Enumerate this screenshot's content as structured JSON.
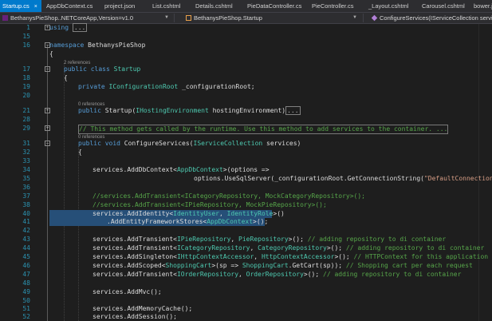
{
  "tabs": [
    {
      "label": "Startup.cs",
      "active": true
    },
    {
      "label": "AppDbContext.cs"
    },
    {
      "label": "project.json"
    },
    {
      "label": "List.cshtml"
    },
    {
      "label": "Details.cshtml"
    },
    {
      "label": "PieDataController.cs"
    },
    {
      "label": "PieController.cs"
    },
    {
      "label": "_Layout.cshtml"
    },
    {
      "label": "Carousel.cshtml"
    },
    {
      "label": "bower.js"
    }
  ],
  "nav": {
    "project": "BethanysPieShop..NETCoreApp,Version=v1.0",
    "class": "BethanysPieShop.Startup",
    "member": "ConfigureServices(IServiceCollection services)"
  },
  "colors": {
    "accent": "#007acc",
    "keyword": "#569cd6",
    "type": "#4ec9b0",
    "comment": "#57a64a",
    "string": "#d69d85",
    "linenum": "#2b91af",
    "selection": "#264f78"
  },
  "lines": [
    {
      "n": "1",
      "t": "using ..."
    },
    {
      "n": "15",
      "t": ""
    },
    {
      "n": "16",
      "t": "namespace BethanysPieShop"
    },
    {
      "n": "",
      "t": "{"
    },
    {
      "ref": "2 references"
    },
    {
      "n": "17",
      "t": "public class Startup"
    },
    {
      "n": "18",
      "t": "{"
    },
    {
      "n": "19",
      "t": "private IConfigurationRoot _configurationRoot;"
    },
    {
      "n": "20",
      "t": ""
    },
    {
      "ref": "0 references"
    },
    {
      "n": "21",
      "t": "public Startup(IHostingEnvironment hostingEnvironment)..."
    },
    {
      "n": "28",
      "t": ""
    },
    {
      "n": "29",
      "t": "// This method gets called by the runtime. Use this method to add services to the container. ..."
    },
    {
      "ref": "0 references"
    },
    {
      "n": "31",
      "t": "public void ConfigureServices(IServiceCollection services)"
    },
    {
      "n": "32",
      "t": "{"
    },
    {
      "n": "33",
      "t": ""
    },
    {
      "n": "34",
      "t": "services.AddDbContext<AppDbContext>(options =>"
    },
    {
      "n": "35",
      "t": "options.UseSqlServer(_configurationRoot.GetConnectionString(\"DefaultConnection\")));"
    },
    {
      "n": "36",
      "t": ""
    },
    {
      "n": "37",
      "t": "//services.AddTransient<ICategoryRepository, MockCategoryRepository>();"
    },
    {
      "n": "38",
      "t": "//services.AddTransient<IPieRepository, MockPieRepository>();"
    },
    {
      "n": "39",
      "t": ""
    },
    {
      "n": "40",
      "t": "services.AddIdentity<IdentityUser, IdentityRole>()"
    },
    {
      "n": "41",
      "t": ".AddEntityFrameworkStores<AppDbContext>();"
    },
    {
      "n": "42",
      "t": ""
    },
    {
      "n": "43",
      "t": "services.AddTransient<IPieRepository, PieRepository>(); // adding repository to di container"
    },
    {
      "n": "44",
      "t": "services.AddTransient<ICategoryRepository, CategoryRepository>(); // adding repository to di container"
    },
    {
      "n": "45",
      "t": "services.AddSingleton<IHttpContextAccessor, HttpContextAccessor>(); // HTTPContext for this application"
    },
    {
      "n": "46",
      "t": "services.AddScoped<ShoppingCart>(sp => ShoppingCart.GetCart(sp)); // Shopping cart per each request"
    },
    {
      "n": "47",
      "t": "services.AddTransient<IOrderRepository, OrderRepository>(); // adding repository to di container"
    },
    {
      "n": "48",
      "t": ""
    },
    {
      "n": "49",
      "t": "services.AddMvc();"
    },
    {
      "n": "50",
      "t": ""
    },
    {
      "n": "51",
      "t": "services.AddMemoryCache();"
    },
    {
      "n": "52",
      "t": "services.AddSession();"
    }
  ]
}
